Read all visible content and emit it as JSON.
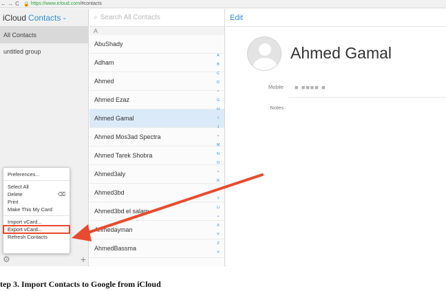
{
  "browser": {
    "back": "←",
    "forward": "→",
    "reload": "C",
    "url_scheme": "https://",
    "url_host": "www.icloud.com",
    "url_path": "/#contacts"
  },
  "groups": {
    "brand": "iCloud",
    "section": "Contacts",
    "items": [
      {
        "label": "All Contacts"
      },
      {
        "label": "untitled group"
      }
    ]
  },
  "menu": {
    "items": [
      {
        "label": "Preferences..."
      },
      {
        "label": "Select All"
      },
      {
        "label": "Delete",
        "shortcut": "⌫"
      },
      {
        "label": "Print"
      },
      {
        "label": "Make This My Card"
      },
      {
        "label": "Import vCard..."
      },
      {
        "label": "Export vCard..."
      },
      {
        "label": "Refresh Contacts"
      }
    ]
  },
  "list": {
    "search_placeholder": "Search All Contacts",
    "section_letter": "A",
    "contacts": [
      {
        "name": "AbuShady"
      },
      {
        "name": "Adham"
      },
      {
        "name": "Ahmed"
      },
      {
        "name": "Ahmed Ezaz"
      },
      {
        "name": "Ahmed Gamal"
      },
      {
        "name": "Ahmed Mos3ad Spectra"
      },
      {
        "name": "Ahmed Tarek Shobra"
      },
      {
        "name": "Ahmed3aly"
      },
      {
        "name": "Ahmed3bd"
      },
      {
        "name": "Ahmed3bd el salam"
      },
      {
        "name": "Ahmedayman"
      },
      {
        "name": "AhmedBassma"
      }
    ],
    "index": [
      "A",
      "B",
      "C",
      "D",
      "•",
      "G",
      "H",
      "I",
      "J",
      "•",
      "M",
      "N",
      "O",
      "•",
      "R",
      "•",
      "T",
      "U",
      "•",
      "X",
      "Y",
      "Z",
      "#"
    ]
  },
  "detail": {
    "edit_label": "Edit",
    "name": "Ahmed Gamal",
    "mobile_label": "Mobile",
    "mobile_value": "■ ■■■■ ■",
    "notes_label": "Notes"
  },
  "caption": "tep 3. Import Contacts to Google from iCloud",
  "colors": {
    "accent": "#2f8cd6",
    "arrow": "#e84a2f",
    "selected_row": "#daeaf8"
  }
}
